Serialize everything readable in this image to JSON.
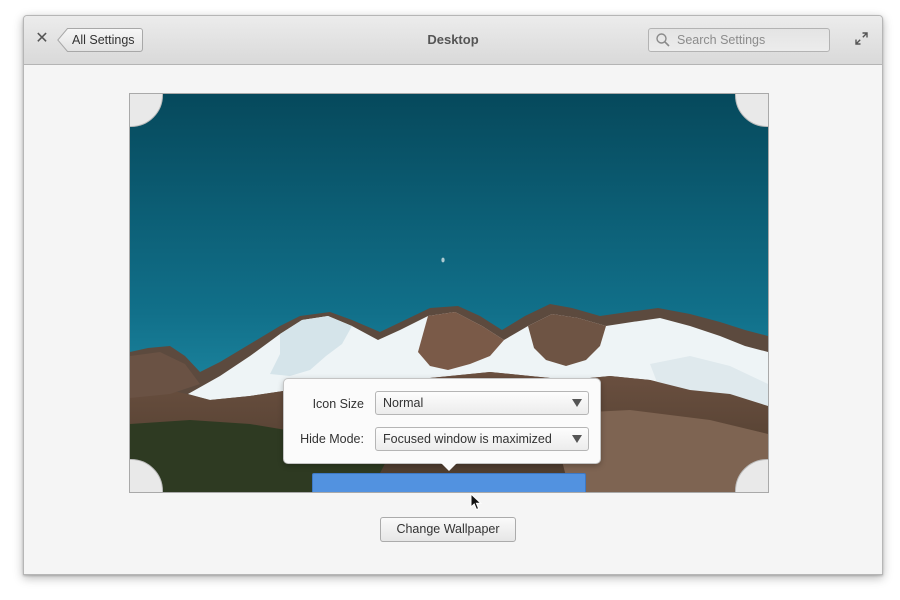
{
  "header": {
    "back_label": "All Settings",
    "title": "Desktop",
    "search_placeholder": "Search Settings",
    "close_symbol": "✕"
  },
  "dock_settings": {
    "icon_size_label": "Icon Size",
    "icon_size_value": "Normal",
    "hide_mode_label": "Hide Mode:",
    "hide_mode_value": "Focused window is maximized"
  },
  "actions": {
    "change_wallpaper_label": "Change Wallpaper"
  },
  "icons": {
    "close": "close-icon",
    "back": "back-arrow-icon",
    "search": "search-icon",
    "maximize": "maximize-icon",
    "dropdown": "chevron-down-icon",
    "cursor": "cursor-icon"
  },
  "colors": {
    "dock_accent": "#5292e0",
    "sky": "#0d5a6e"
  }
}
